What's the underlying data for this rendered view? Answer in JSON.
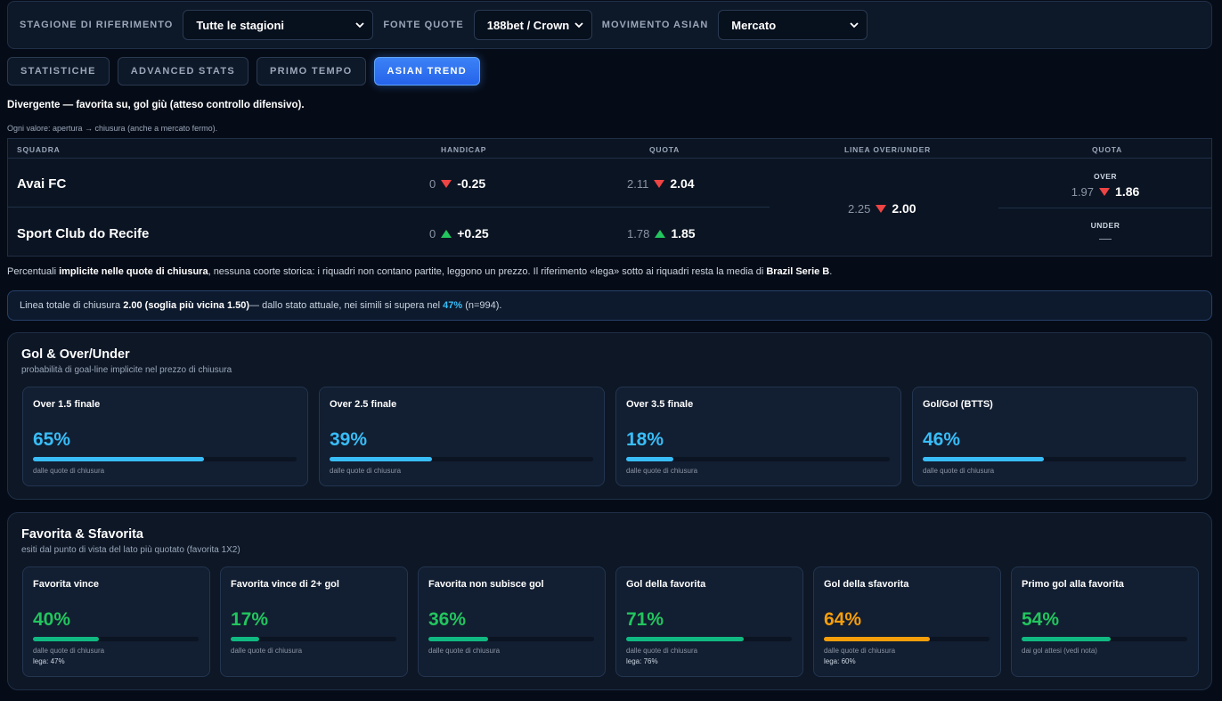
{
  "filters": {
    "season": {
      "label": "STAGIONE DI RIFERIMENTO",
      "value": "Tutte le stagioni"
    },
    "source": {
      "label": "FONTE QUOTE",
      "value": "188bet / Crown"
    },
    "movement": {
      "label": "MOVIMENTO ASIAN",
      "value": "Mercato"
    }
  },
  "tabs": [
    "STATISTICHE",
    "ADVANCED STATS",
    "PRIMO TEMPO",
    "ASIAN TREND"
  ],
  "active_tab": "ASIAN TREND",
  "verdict": "Divergente — favorita su, gol giù (atteso controllo difensivo).",
  "note": "Ogni valore: apertura → chiusura (anche a mercato fermo).",
  "table": {
    "headers": {
      "team": "SQUADRA",
      "handicap": "HANDICAP",
      "quota": "QUOTA",
      "ou_line": "LINEA OVER/UNDER",
      "ou_quota": "QUOTA"
    },
    "rows": [
      {
        "team": "Avai FC",
        "hcp_open": "0",
        "hcp_close": "-0.25",
        "hcp_dir": "down",
        "q_open": "2.11",
        "q_close": "2.04",
        "q_dir": "down"
      },
      {
        "team": "Sport Club do Recife",
        "hcp_open": "0",
        "hcp_close": "+0.25",
        "hcp_dir": "up",
        "q_open": "1.78",
        "q_close": "1.85",
        "q_dir": "up"
      }
    ],
    "ou_line": {
      "open": "2.25",
      "close": "2.00",
      "dir": "down"
    },
    "over": {
      "label": "OVER",
      "open": "1.97",
      "close": "1.86",
      "dir": "down"
    },
    "under": {
      "label": "UNDER"
    }
  },
  "explain": {
    "p1": "Percentuali ",
    "b1": "implicite nelle quote di chiusura",
    "p2": ", nessuna coorte storica: i riquadri non contano partite, leggono un prezzo. Il riferimento «lega» sotto ai riquadri resta la media di ",
    "b2": "Brazil Serie B",
    "p3": "."
  },
  "line_box": {
    "p1": "Linea totale di chiusura ",
    "b1": "2.00 (soglia più vicina 1.50)",
    "p2": " — dallo stato attuale, nei simili si supera nel ",
    "hl": "47%",
    "p3": " (n=994)."
  },
  "goals_section": {
    "title": "Gol & Over/Under",
    "subtitle": "probabilità di goal-line implicite nel prezzo di chiusura",
    "cards": [
      {
        "title": "Over 1.5 finale",
        "value": "65%",
        "pct": 65,
        "src": "dalle quote di chiusura"
      },
      {
        "title": "Over 2.5 finale",
        "value": "39%",
        "pct": 39,
        "src": "dalle quote di chiusura"
      },
      {
        "title": "Over 3.5 finale",
        "value": "18%",
        "pct": 18,
        "src": "dalle quote di chiusura"
      },
      {
        "title": "Gol/Gol (BTTS)",
        "value": "46%",
        "pct": 46,
        "src": "dalle quote di chiusura"
      }
    ]
  },
  "fav_section": {
    "title": "Favorita & Sfavorita",
    "subtitle": "esiti dal punto di vista del lato più quotato (favorita 1X2)",
    "cards": [
      {
        "title": "Favorita vince",
        "value": "40%",
        "pct": 40,
        "src": "dalle quote di chiusura",
        "lega": "lega: 47%",
        "color": "green"
      },
      {
        "title": "Favorita vince di 2+ gol",
        "value": "17%",
        "pct": 17,
        "src": "dalle quote di chiusura",
        "lega": "",
        "color": "green"
      },
      {
        "title": "Favorita non subisce gol",
        "value": "36%",
        "pct": 36,
        "src": "dalle quote di chiusura",
        "lega": "",
        "color": "green"
      },
      {
        "title": "Gol della favorita",
        "value": "71%",
        "pct": 71,
        "src": "dalle quote di chiusura",
        "lega": "lega: 76%",
        "color": "green"
      },
      {
        "title": "Gol della sfavorita",
        "value": "64%",
        "pct": 64,
        "src": "dalle quote di chiusura",
        "lega": "lega: 60%",
        "color": "orange"
      },
      {
        "title": "Primo gol alla favorita",
        "value": "54%",
        "pct": 54,
        "src": "dai gol attesi (vedi nota)",
        "lega": "",
        "color": "green"
      }
    ]
  },
  "colors": {
    "accent_blue": "#38bdf8",
    "green": "#10b981",
    "orange": "#f59e0b",
    "down": "#ef4444",
    "up": "#22c55e"
  }
}
